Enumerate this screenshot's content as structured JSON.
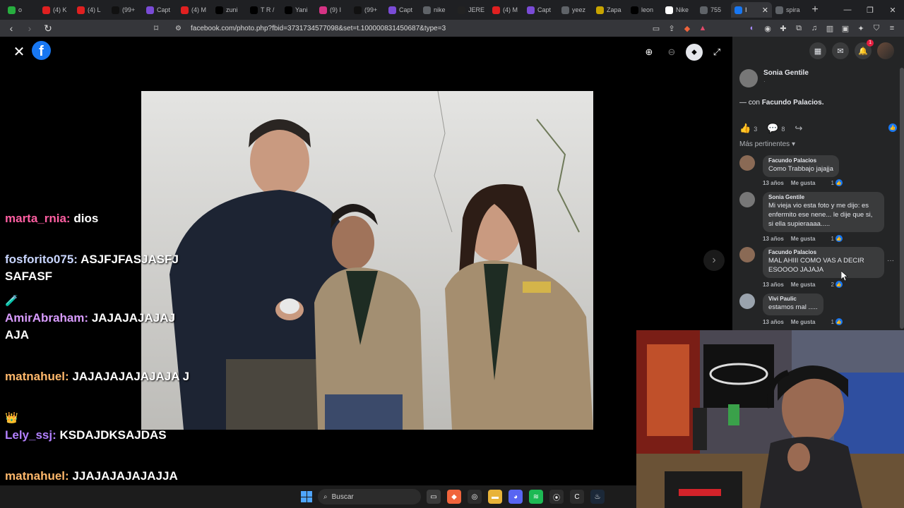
{
  "browser": {
    "tabs": [
      {
        "label": "o",
        "color": "#27ae3f"
      },
      {
        "label": "(4) K",
        "color": "#e02020"
      },
      {
        "label": "(4) L",
        "color": "#e02020"
      },
      {
        "label": "(99+",
        "color": "#111111"
      },
      {
        "label": "Capt",
        "color": "#7a4bd6"
      },
      {
        "label": "(4) M",
        "color": "#e02020"
      },
      {
        "label": "zuni",
        "color": "#000000"
      },
      {
        "label": "T R /",
        "color": "#000000"
      },
      {
        "label": "Yani",
        "color": "#000000"
      },
      {
        "label": "(9) I",
        "color": "#d63384"
      },
      {
        "label": "(99+",
        "color": "#111111"
      },
      {
        "label": "Capt",
        "color": "#7a4bd6"
      },
      {
        "label": "nike",
        "color": "#5f6368"
      },
      {
        "label": "JERE",
        "color": "#222222"
      },
      {
        "label": "(4) M",
        "color": "#e02020"
      },
      {
        "label": "Capt",
        "color": "#7a4bd6"
      },
      {
        "label": "yeez",
        "color": "#5f6368"
      },
      {
        "label": "Zapa",
        "color": "#c8a400"
      },
      {
        "label": "leon",
        "color": "#000000"
      },
      {
        "label": "Nike",
        "color": "#ffffff"
      },
      {
        "label": "755",
        "color": "#5f6368"
      },
      {
        "label": "I",
        "color": "#1877f2",
        "active": true
      },
      {
        "label": "spira",
        "color": "#5f6368"
      }
    ],
    "url": "facebook.com/photo.php?fbid=3731734577098&set=t.100000831450687&type=3"
  },
  "panel": {
    "poster_name": "Sonia Gentile",
    "poster_sub": "·",
    "with_prefix": "— con",
    "with_name": "Facundo Palacios.",
    "likes": "3",
    "comments": "8",
    "sort_label": "Más pertinentes",
    "notif_count": "1",
    "comment_list": [
      {
        "author": "Facundo Palacios",
        "text": "Como Trabbajo jajajja",
        "time": "13 años",
        "like": "Me gusta",
        "count": "1",
        "avatar": "#8a6a55"
      },
      {
        "author": "Sonia Gentile",
        "text": "Mi vieja vio esta foto y me dijo: es enfermito ese nene... le dije que si, si ella supieraaaa.....",
        "time": "13 años",
        "like": "Me gusta",
        "count": "1",
        "avatar": "#777777"
      },
      {
        "author": "Facundo Palacios",
        "text": "MAL AHIII COMO VAS A DECIR ESOOOO JAJAJA",
        "time": "13 años",
        "like": "Me gusta",
        "count": "2",
        "avatar": "#8a6a55"
      },
      {
        "author": "Vivi Paulic",
        "text": "estamos mal .....",
        "time": "13 años",
        "like": "Me gusta",
        "count": "1",
        "avatar": "#9aa3ad"
      }
    ]
  },
  "chat": {
    "lines": [
      {
        "user": "marta_rnia:",
        "msg": "dios",
        "color": "#ff5fa2"
      },
      {
        "user": "fosforito075:",
        "msg": "ASJFJFASJASFJ SAFASF",
        "color": "#c9d6ff"
      },
      {
        "user": "AmirAbraham:",
        "msg": "JAJAJAJAJAJ AJA",
        "color": "#d99cff"
      },
      {
        "user": "matnahuel:",
        "msg": "JAJAJAJAJAJAJA J",
        "color": "#ffb86b"
      },
      {
        "user": "Lely_ssj:",
        "msg": "KSDAJDKSAJDAS",
        "color": "#b380ff"
      },
      {
        "user": "matnahuel:",
        "msg": "JJAJAJAJAJAJJA JA",
        "color": "#ffb86b"
      }
    ],
    "emotes": [
      "🧪",
      "👑"
    ]
  },
  "taskbar": {
    "search_label": "Buscar"
  }
}
